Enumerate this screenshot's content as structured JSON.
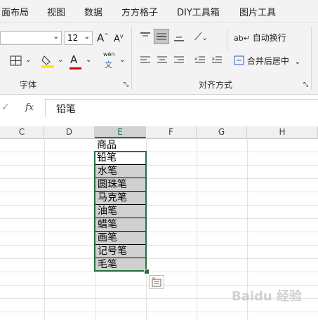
{
  "menu": [
    "面布局",
    "视图",
    "数据",
    "方方格子",
    "DIY工具箱",
    "图片工具"
  ],
  "ribbon": {
    "font_size": "12",
    "font_group_label": "字体",
    "align_group_label": "对齐方式",
    "wrap_text_label": "自动换行",
    "merge_center_label": "合并后居中",
    "phonetic_top": "wén",
    "phonetic_bottom": "文",
    "grow_font": "A",
    "shrink_font": "A",
    "font_color_letter": "A",
    "colors": {
      "highlight": "#ffeb00",
      "font_color": "#e00000",
      "accent": "#217346"
    }
  },
  "formula_bar": {
    "fx_label": "fx",
    "value": "铅笔"
  },
  "columns": [
    "C",
    "D",
    "E",
    "F",
    "G",
    "H"
  ],
  "cells": {
    "header": "商品",
    "items": [
      "铅笔",
      "水笔",
      "圆珠笔",
      "马克笔",
      "油笔",
      "蜡笔",
      "画笔",
      "记号笔",
      "毛笔"
    ]
  },
  "watermark": "Baidu 经验"
}
